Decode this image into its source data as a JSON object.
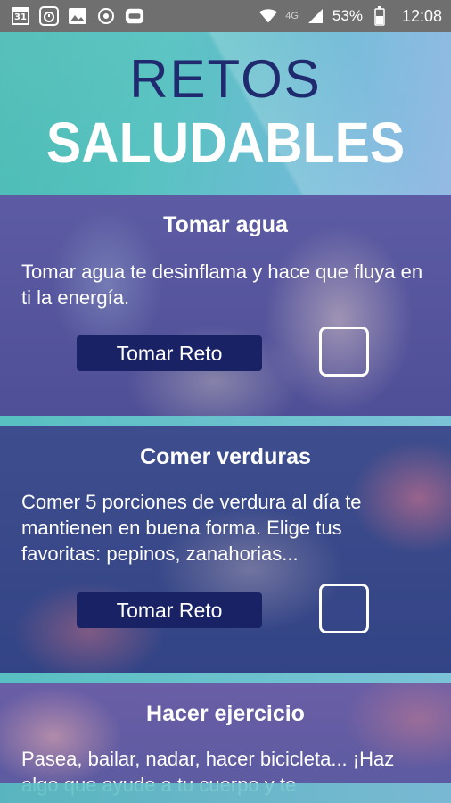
{
  "status_bar": {
    "calendar_day": "31",
    "network": "4G",
    "battery_percent": "53%",
    "time": "12:08",
    "icons_left": [
      "calendar-icon",
      "timer-app-icon",
      "image-icon",
      "shield-app-icon",
      "assistant-app-icon"
    ],
    "icons_right": [
      "wifi-icon",
      "signal-icon",
      "battery-icon"
    ]
  },
  "header": {
    "title_line1": "RETOS",
    "title_line2": "SALUDABLES",
    "title_line1_color": "#1f2b6e",
    "title_line2_color": "#ffffff"
  },
  "challenges": [
    {
      "title": "Tomar agua",
      "description": "Tomar agua te desinflama y hace que fluya en ti la energía.",
      "button_label": "Tomar Reto",
      "checked": false
    },
    {
      "title": "Comer verduras",
      "description": "Comer 5 porciones de verdura al día te mantienen en buena forma. Elige tus favoritas: pepinos, zanahorias...",
      "button_label": "Tomar Reto",
      "checked": false
    },
    {
      "title": "Hacer ejercicio",
      "description": "Pasea, bailar, nadar, hacer bicicleta... ¡Haz algo que ayude a tu cuerpo y te",
      "button_label": "",
      "checked": false
    }
  ],
  "colors": {
    "button_bg": "#1a2266",
    "accent_teal": "#58bfc2"
  }
}
